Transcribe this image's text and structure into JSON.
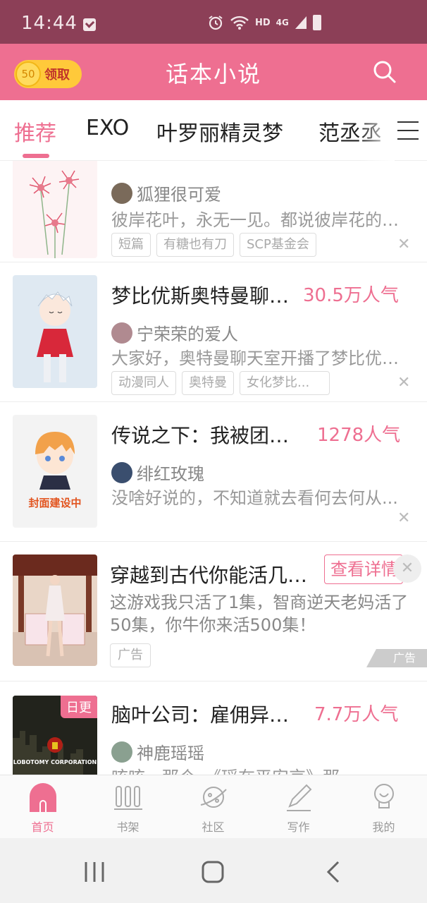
{
  "status_bar": {
    "time": "14:44",
    "net_label": "HD",
    "net_type": "4G"
  },
  "header": {
    "coins": "50",
    "claim_label": "领取",
    "title": "话本小说",
    "search_icon": "search-icon"
  },
  "tabs": [
    {
      "label": "推荐",
      "active": true
    },
    {
      "label": "EXO"
    },
    {
      "label": "叶罗丽精灵梦"
    },
    {
      "label": "范丞丞"
    }
  ],
  "feed": [
    {
      "author": "狐狸很可爱",
      "desc": "彼岸花叶，永无一见。都说彼岸花的传说...",
      "tags": [
        "短篇",
        "有糖也有刀",
        "SCP基金会"
      ]
    },
    {
      "title": "梦比优斯奥特曼聊天室",
      "popularity": "30.5万人气",
      "author": "宁荣荣的爱人",
      "desc": "大家好，奥特曼聊天室开播了梦比优斯...",
      "tags": [
        "动漫同人",
        "奥特曼",
        "女化梦比..."
      ]
    },
    {
      "title": "传说之下：我被团宠了",
      "popularity": "1278人气",
      "author": "绯红玫瑰",
      "desc": "没啥好说的，不知道就去看何去何从...",
      "cover_text": "封面建设中"
    },
    {
      "ad": true,
      "title": "穿越到古代你能活几集？",
      "cta": "查看详情",
      "desc": "这游戏我只活了1集，智商逆天老妈活了50集，你牛你来活500集！",
      "tag": "广告",
      "ad_mark": "广告"
    },
    {
      "title": "脑叶公司：雇佣异想体",
      "popularity": "7.7万人气",
      "author": "神鹿瑶瑶",
      "desc": "咳咳，那个，《瑶在平安京》那",
      "badge": "日更",
      "cover_text": "LOBOTOMY CORPORATION"
    }
  ],
  "bottom_nav": [
    {
      "label": "首页",
      "icon": "home-icon",
      "active": true
    },
    {
      "label": "书架",
      "icon": "bookshelf-icon"
    },
    {
      "label": "社区",
      "icon": "community-planet-icon"
    },
    {
      "label": "写作",
      "icon": "pen-icon"
    },
    {
      "label": "我的",
      "icon": "profile-icon"
    }
  ],
  "colors": {
    "accent": "#ee6f91",
    "status_bar": "#8c3f57",
    "coin": "#ffc93a"
  }
}
